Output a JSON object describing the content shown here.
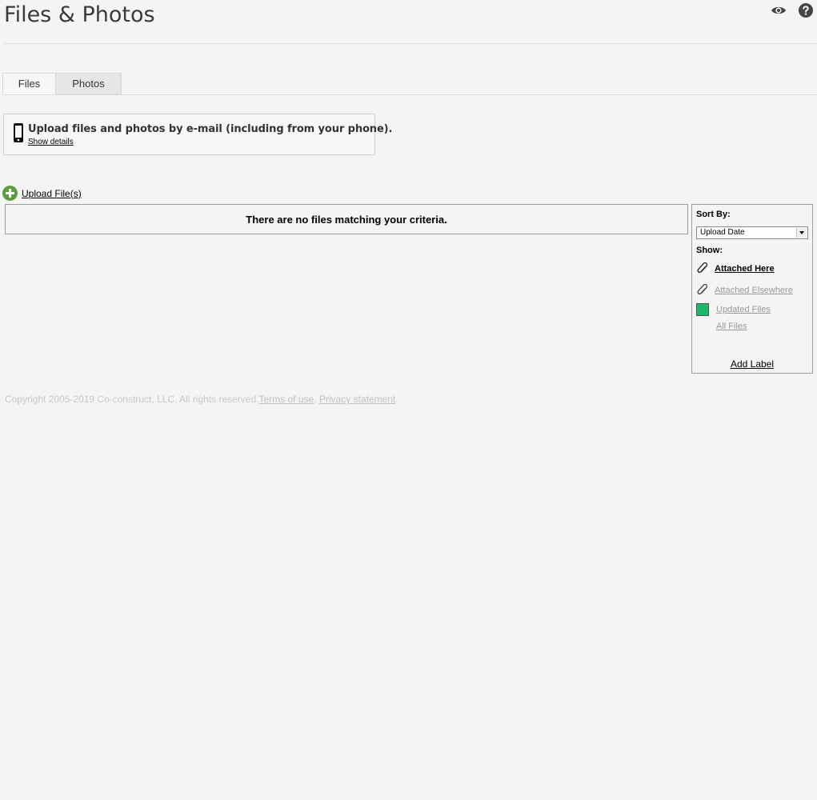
{
  "page": {
    "title": "Files & Photos"
  },
  "header_icons": [
    "eye-icon",
    "help-icon"
  ],
  "tabs": [
    {
      "label": "Files",
      "active": true
    },
    {
      "label": "Photos",
      "active": false
    }
  ],
  "email_upload": {
    "message": "Upload files and photos by e-mail (including from your phone).",
    "details_link": "Show details"
  },
  "upload": {
    "label": "Upload File(s)"
  },
  "results": {
    "empty_message": "There are no files matching your criteria."
  },
  "sidebar": {
    "sort_label": "Sort By:",
    "sort_selected": "Upload Date",
    "show_label": "Show:",
    "filters": {
      "attached_here": "Attached Here",
      "attached_elsewhere": "Attached Elsewhere",
      "updated_files": "Updated Files",
      "all_files": "All Files"
    },
    "add_label": "Add Label"
  },
  "footer": {
    "copyright": "Copyright 2005-2019 Co-construct, LLC. All rights reserved.",
    "terms": "Terms of use",
    "sep": ".",
    "privacy": "Privacy statement",
    "end": "."
  },
  "colors": {
    "background": "#f4f4f4",
    "accent_green": "#5a9e3e",
    "updated_swatch": "#1fb86a"
  }
}
